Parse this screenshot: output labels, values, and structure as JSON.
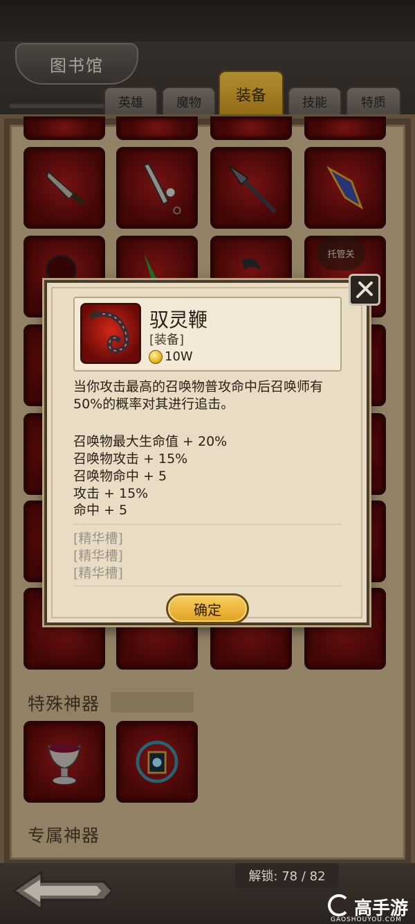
{
  "library": {
    "title": "图书馆"
  },
  "tabs": [
    {
      "label": "英雄"
    },
    {
      "label": "魔物"
    },
    {
      "label": "装备",
      "active": true
    },
    {
      "label": "技能"
    },
    {
      "label": "特质"
    }
  ],
  "trust_button": {
    "label": "托管关"
  },
  "sections": {
    "special_artifacts": "特殊神器",
    "exclusive_artifacts": "专属神器"
  },
  "item_dialog": {
    "name": "驭灵鞭",
    "type": "[装备]",
    "price": "10W",
    "description": "当你攻击最高的召唤物普攻命中后召唤师有50%的概率对其进行追击。",
    "stats": [
      "召唤物最大生命值 + 20%",
      "召唤物攻击 + 15%",
      "召唤物命中 + 5",
      "攻击 + 15%",
      "命中 + 5"
    ],
    "sockets": [
      "[精华槽]",
      "[精华槽]",
      "[精华槽]"
    ],
    "confirm_label": "确定"
  },
  "footer": {
    "unlock": "解锁: 78 / 82"
  },
  "watermark": {
    "brand": "高手游",
    "url": "GAOSHOUYOU.COM"
  },
  "colors": {
    "slot_red": "#a31a1a",
    "gold": "#f4c542",
    "parchment": "#e8dcc4"
  }
}
